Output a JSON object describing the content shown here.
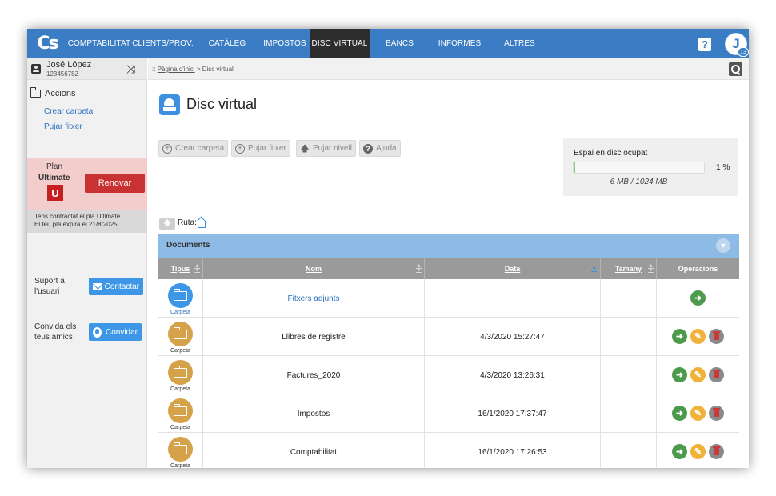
{
  "nav": {
    "logo": "Cs",
    "items": [
      {
        "label": "COMPTABILITAT",
        "active": false
      },
      {
        "label": "CLIENTS/PROV.",
        "active": false
      },
      {
        "label": "CATÀLEG",
        "active": false
      },
      {
        "label": "IMPOSTOS",
        "active": false
      },
      {
        "label": "DISC VIRTUAL",
        "active": true
      },
      {
        "label": "BANCS",
        "active": false
      },
      {
        "label": "INFORMES",
        "active": false
      },
      {
        "label": "ALTRES",
        "active": false
      }
    ],
    "help": "?",
    "avatar_letter": "J",
    "avatar_badge": "13",
    "accent": "#3b7dc4"
  },
  "user": {
    "name": "José López",
    "id": "12345678Z"
  },
  "sidebar": {
    "accions_title": "Accions",
    "links": [
      "Crear carpeta",
      "Pujar fitxer"
    ],
    "plan": {
      "label": "Plan",
      "name": "Ultimate",
      "logo": "U",
      "renew": "Renovar",
      "info_line1": "Tens contractat el pla Ultimate.",
      "info_line2": "El teu pla expira el 21/8/2025."
    },
    "support": {
      "line1": "Suport a",
      "line2": "l'usuari",
      "button": "Contactar"
    },
    "invite": {
      "line1": "Convida els",
      "line2": "teus amics",
      "button": "Convidar"
    }
  },
  "breadcrumb": {
    "prefix": "::",
    "home": "Pàgina d'inici",
    "sep": ">",
    "current": "Disc virtual"
  },
  "page": {
    "title": "Disc virtual"
  },
  "toolbar": {
    "create_folder": "Crear carpeta",
    "upload": "Pujar fitxer",
    "level_up": "Pujar nivell",
    "help": "Ajuda"
  },
  "disk": {
    "title": "Espai en disc ocupat",
    "percent_label": "1 %",
    "percent_value": 0.01,
    "usage": "6 MB / 1024 MB"
  },
  "path": {
    "label": "Ruta:"
  },
  "documents": {
    "title": "Documents",
    "columns": {
      "tipus": "Tipus",
      "nom": "Nom",
      "data": "Data",
      "tamany": "Tamany",
      "operacions": "Operacions"
    },
    "rows": [
      {
        "type": "Carpeta",
        "name": "Fitxers adjunts",
        "date": "",
        "size": "",
        "special": true
      },
      {
        "type": "Carpeta",
        "name": "Llibres de registre",
        "date": "4/3/2020 15:27:47",
        "size": "",
        "special": false
      },
      {
        "type": "Carpeta",
        "name": "Factures_2020",
        "date": "4/3/2020 13:26:31",
        "size": "",
        "special": false
      },
      {
        "type": "Carpeta",
        "name": "Impostos",
        "date": "16/1/2020 17:37:47",
        "size": "",
        "special": false
      },
      {
        "type": "Carpeta",
        "name": "Comptabilitat",
        "date": "16/1/2020 17:26:53",
        "size": "",
        "special": false
      }
    ]
  }
}
